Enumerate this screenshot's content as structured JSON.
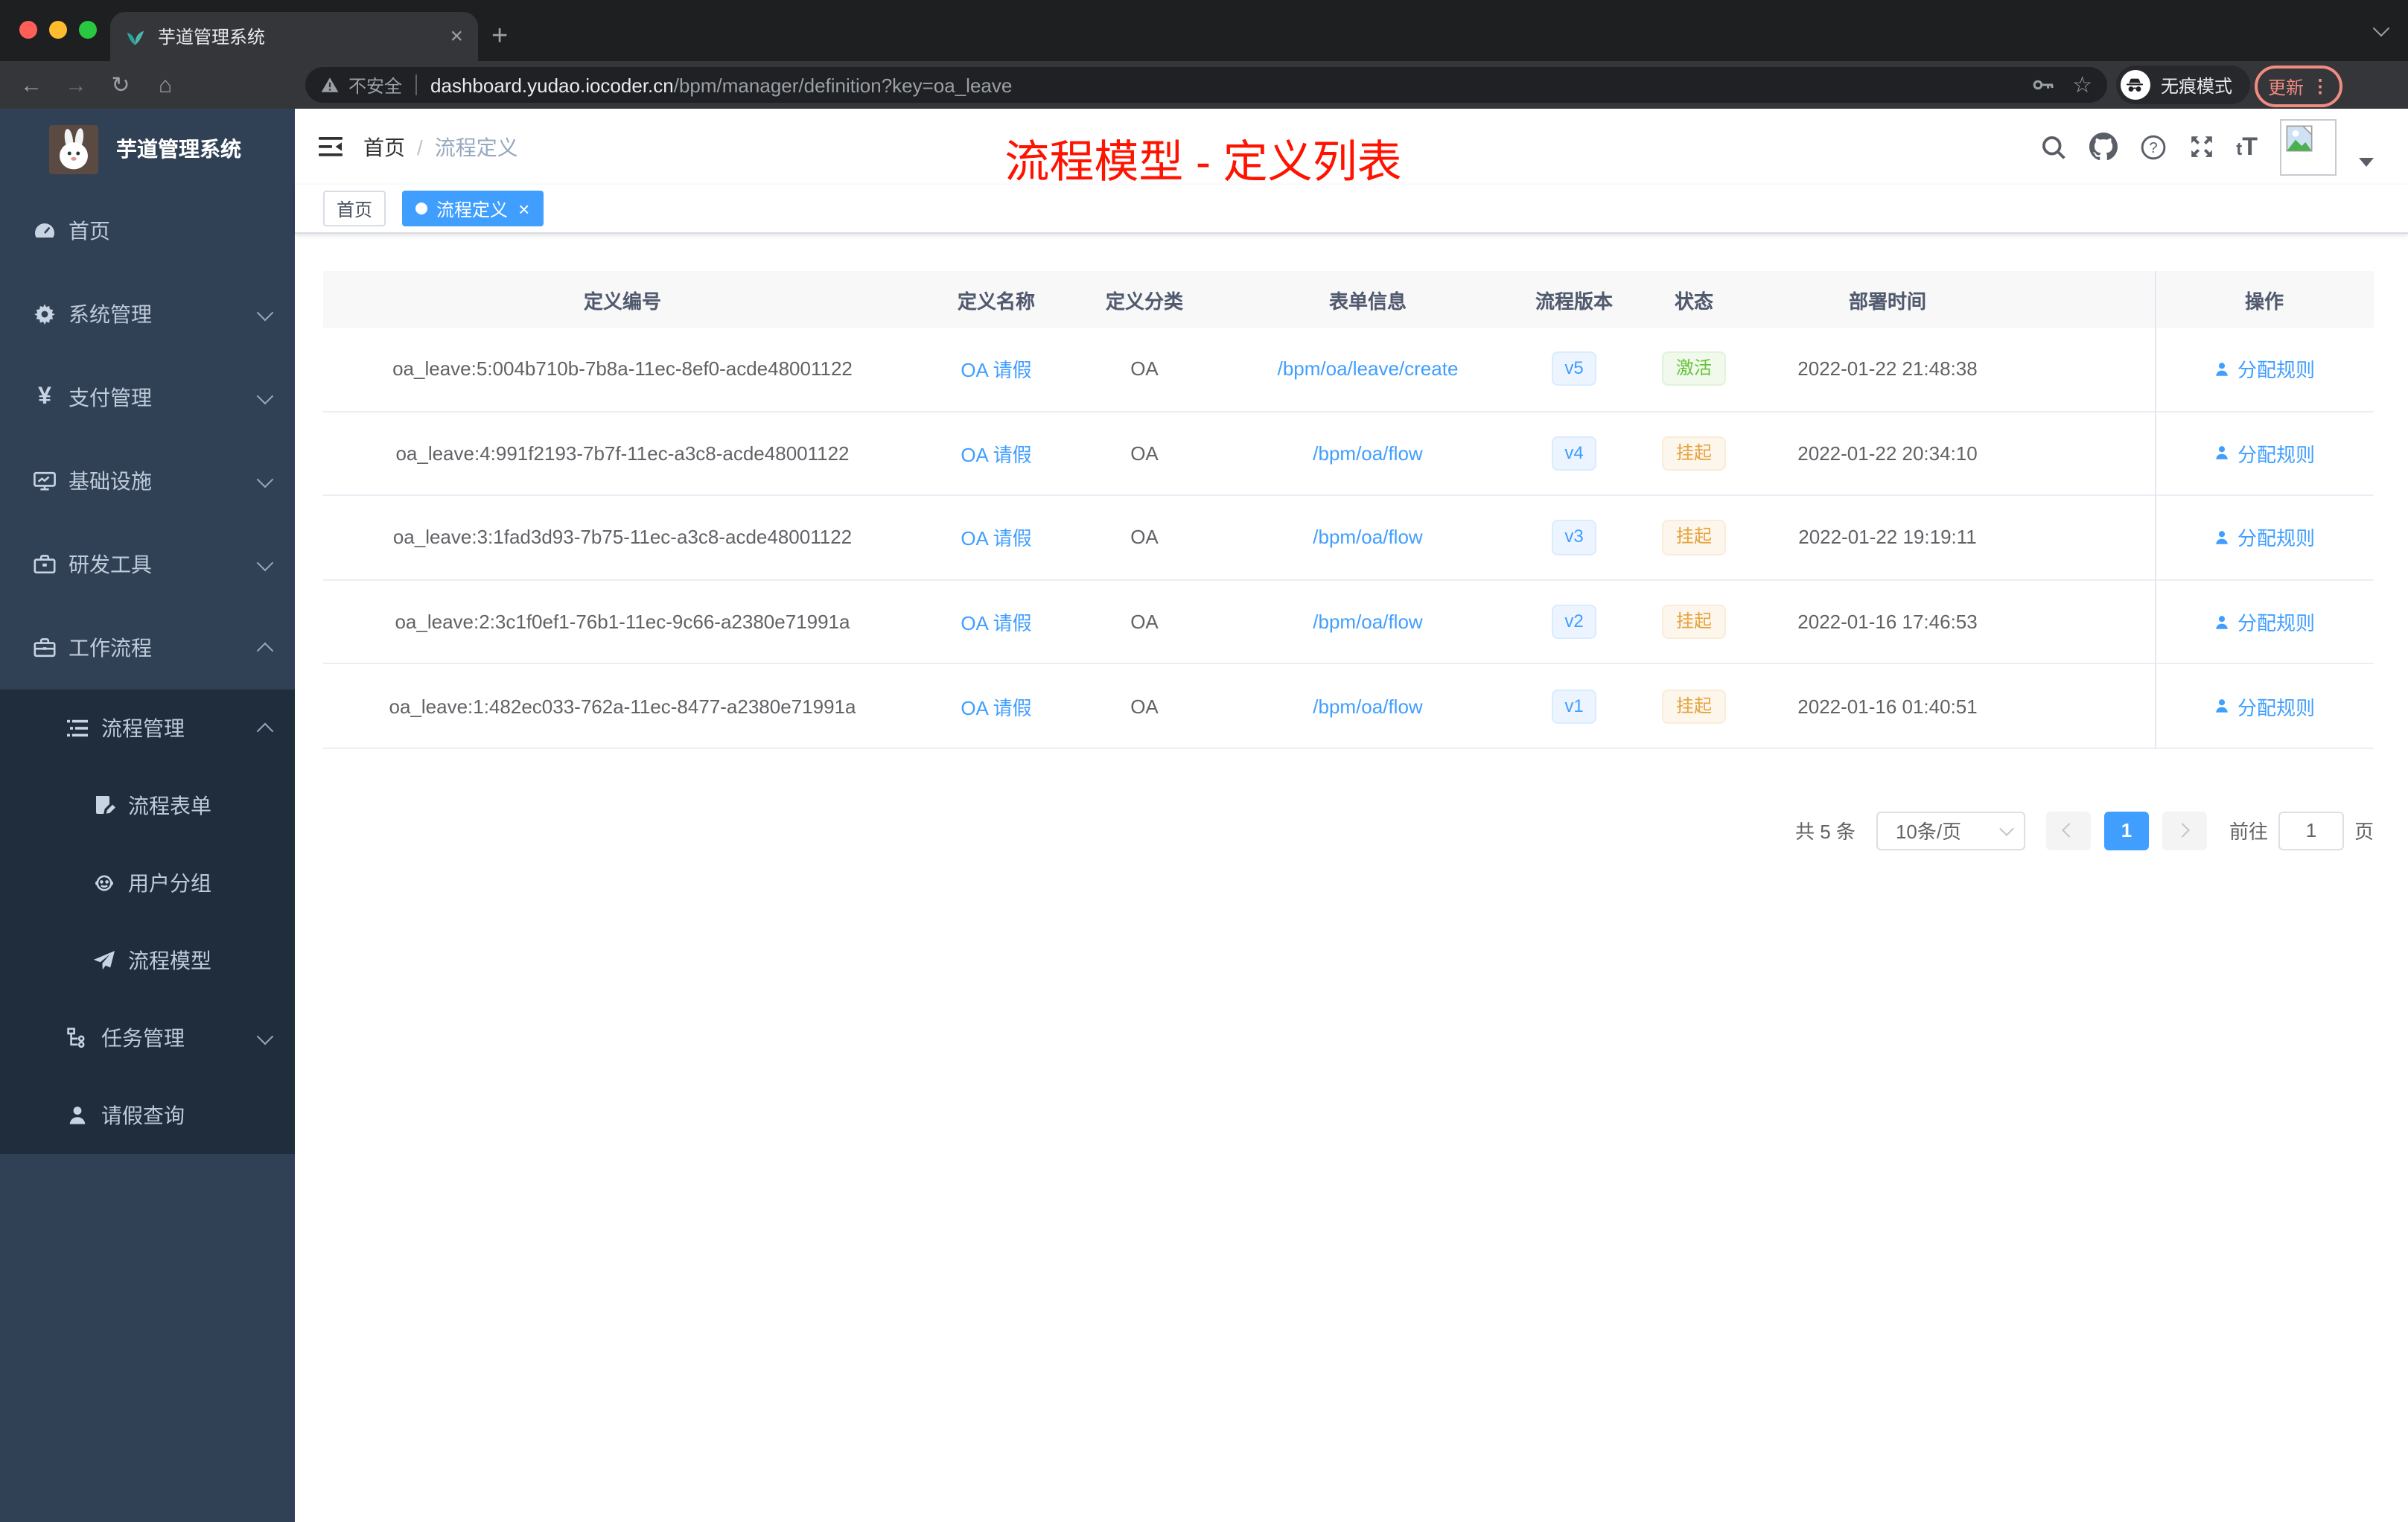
{
  "colors": {
    "accent": "#409eff",
    "sidebar": "#304156",
    "submenu": "#1f2d3d",
    "annotation": "#ff1200",
    "success": "#67c23a",
    "warning": "#e6a23c",
    "update_badge": "#f28b82"
  },
  "browser": {
    "tab_title": "芋道管理系统",
    "tab_close": "×",
    "new_tab": "+",
    "back_icon": "←",
    "forward_icon": "→",
    "reload_icon": "↻",
    "home_icon": "⌂",
    "security_label": "不安全",
    "url_host": "dashboard.yudao.iocoder.cn",
    "url_path": "/bpm/manager/definition?key=oa_leave",
    "star_icon": "☆",
    "incognito_label": "无痕模式",
    "update_label": "更新",
    "menu_dots": "⋮"
  },
  "sidebar": {
    "title": "芋道管理系统",
    "items": [
      {
        "label": "首页",
        "icon": "dashboard-icon"
      },
      {
        "label": "系统管理",
        "icon": "gear-icon"
      },
      {
        "label": "支付管理",
        "icon": "yen-icon"
      },
      {
        "label": "基础设施",
        "icon": "monitor-icon"
      },
      {
        "label": "研发工具",
        "icon": "toolbox-icon"
      },
      {
        "label": "工作流程",
        "icon": "briefcase-icon"
      }
    ],
    "yen_glyph": "¥",
    "workflow_children": [
      {
        "label": "流程管理",
        "icon": "list-icon"
      },
      {
        "label": "流程表单",
        "icon": "form-icon"
      },
      {
        "label": "用户分组",
        "icon": "group-icon"
      },
      {
        "label": "流程模型",
        "icon": "send-icon"
      },
      {
        "label": "任务管理",
        "icon": "tree-icon"
      },
      {
        "label": "请假查询",
        "icon": "user-icon"
      }
    ]
  },
  "header": {
    "breadcrumb_home": "首页",
    "breadcrumb_sep": "/",
    "breadcrumb_current": "流程定义",
    "annotation": "流程模型 - 定义列表",
    "font_icon_small": "t",
    "font_icon_big": "T"
  },
  "tags": {
    "home": "首页",
    "active": "流程定义",
    "close": "×"
  },
  "table": {
    "columns": [
      "定义编号",
      "定义名称",
      "定义分类",
      "表单信息",
      "流程版本",
      "状态",
      "部署时间",
      "操作"
    ],
    "rows": [
      {
        "id": "oa_leave:5:004b710b-7b8a-11ec-8ef0-acde48001122",
        "name": "OA 请假",
        "category": "OA",
        "form": "/bpm/oa/leave/create",
        "version": "v5",
        "status": "激活",
        "time": "2022-01-22 21:48:38",
        "action": "分配规则"
      },
      {
        "id": "oa_leave:4:991f2193-7b7f-11ec-a3c8-acde48001122",
        "name": "OA 请假",
        "category": "OA",
        "form": "/bpm/oa/flow",
        "version": "v4",
        "status": "挂起",
        "time": "2022-01-22 20:34:10",
        "action": "分配规则"
      },
      {
        "id": "oa_leave:3:1fad3d93-7b75-11ec-a3c8-acde48001122",
        "name": "OA 请假",
        "category": "OA",
        "form": "/bpm/oa/flow",
        "version": "v3",
        "status": "挂起",
        "time": "2022-01-22 19:19:11",
        "action": "分配规则"
      },
      {
        "id": "oa_leave:2:3c1f0ef1-76b1-11ec-9c66-a2380e71991a",
        "name": "OA 请假",
        "category": "OA",
        "form": "/bpm/oa/flow",
        "version": "v2",
        "status": "挂起",
        "time": "2022-01-16 17:46:53",
        "action": "分配规则"
      },
      {
        "id": "oa_leave:1:482ec033-762a-11ec-8477-a2380e71991a",
        "name": "OA 请假",
        "category": "OA",
        "form": "/bpm/oa/flow",
        "version": "v1",
        "status": "挂起",
        "time": "2022-01-16 01:40:51",
        "action": "分配规则"
      }
    ]
  },
  "pagination": {
    "total": "共 5 条",
    "page_size": "10条/页",
    "page": "1",
    "goto_label": "前往",
    "goto_value": "1",
    "unit": "页"
  }
}
